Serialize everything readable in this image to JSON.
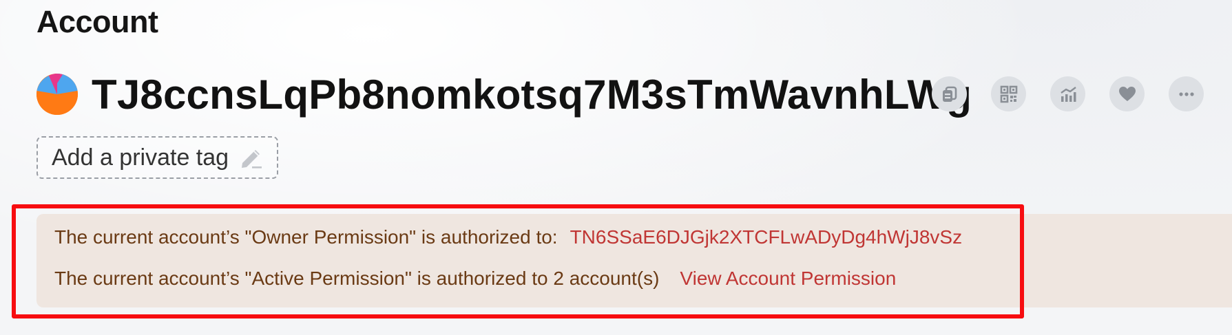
{
  "page": {
    "title": "Account"
  },
  "account": {
    "address": "TJ8ccnsLqPb8nomkotsq7M3sTmWavnhLWg",
    "avatar_icon": "pie-avatar-icon"
  },
  "actions": [
    {
      "name": "copy-button",
      "icon": "copy-icon"
    },
    {
      "name": "qr-code-button",
      "icon": "qr-code-icon"
    },
    {
      "name": "analytics-button",
      "icon": "chart-icon"
    },
    {
      "name": "favorite-button",
      "icon": "heart-icon"
    },
    {
      "name": "more-button",
      "icon": "more-icon"
    }
  ],
  "private_tag": {
    "label": "Add a private tag",
    "icon": "pencil-icon"
  },
  "permissions": {
    "owner_text": "The current account’s \"Owner Permission\" is authorized to:",
    "owner_address": "TN6SSaE6DJGjk2XTCFLwADyDg4hWjJ8vSz",
    "active_text": "The current account’s \"Active Permission\" is authorized to 2 account(s)",
    "view_link": "View Account Permission"
  },
  "colors": {
    "background": "#f4f5f7",
    "panel_bg": "#efe6e0",
    "panel_text": "#6a3a14",
    "link": "#c03634",
    "highlight_border": "#f70d10",
    "icon_button_bg": "#dde0e4",
    "icon_color": "#8a8f96"
  }
}
